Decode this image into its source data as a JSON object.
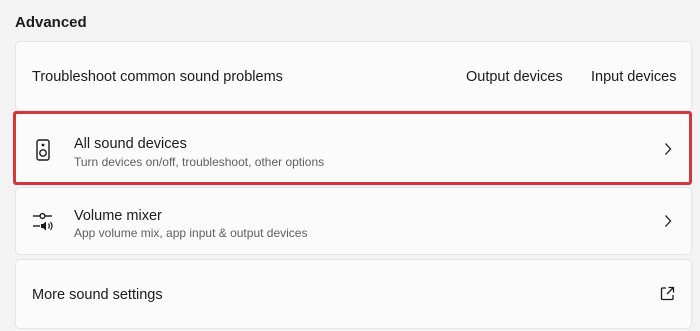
{
  "section": {
    "title": "Advanced"
  },
  "troubleshoot": {
    "label": "Troubleshoot common sound problems",
    "links": [
      "Output devices",
      "Input devices"
    ]
  },
  "all_sound_devices": {
    "title": "All sound devices",
    "subtitle": "Turn devices on/off, troubleshoot, other options",
    "icon": "speaker-icon",
    "highlight_color": "#d0383b"
  },
  "volume_mixer": {
    "title": "Volume mixer",
    "subtitle": "App volume mix, app input & output devices",
    "icon": "mixer-icon"
  },
  "more_sound_settings": {
    "label": "More sound settings",
    "icon": "external-link-icon"
  }
}
